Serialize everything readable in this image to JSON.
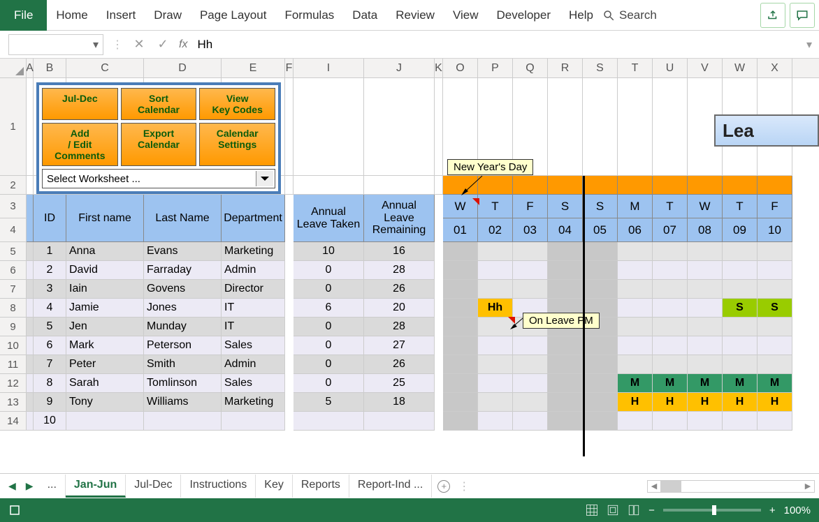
{
  "ribbon": {
    "file": "File",
    "tabs": [
      "Home",
      "Insert",
      "Draw",
      "Page Layout",
      "Formulas",
      "Data",
      "Review",
      "View",
      "Developer",
      "Help"
    ],
    "search": "Search"
  },
  "fx": {
    "value": "Hh"
  },
  "columns": [
    {
      "l": "A",
      "w": 10
    },
    {
      "l": "B",
      "w": 47
    },
    {
      "l": "C",
      "w": 111
    },
    {
      "l": "D",
      "w": 111
    },
    {
      "l": "E",
      "w": 91
    },
    {
      "l": "F",
      "w": 12
    },
    {
      "l": "I",
      "w": 101
    },
    {
      "l": "J",
      "w": 101
    },
    {
      "l": "K",
      "w": 12
    },
    {
      "l": "O",
      "w": 50
    },
    {
      "l": "P",
      "w": 50
    },
    {
      "l": "Q",
      "w": 50
    },
    {
      "l": "R",
      "w": 50
    },
    {
      "l": "S",
      "w": 50
    },
    {
      "l": "T",
      "w": 50
    },
    {
      "l": "U",
      "w": 50
    },
    {
      "l": "V",
      "w": 50
    },
    {
      "l": "W",
      "w": 50
    },
    {
      "l": "X",
      "w": 50
    }
  ],
  "panel": {
    "buttons": [
      [
        "Jul-Dec",
        "Sort Calendar",
        "View Key Codes"
      ],
      [
        "Add / Edit Comments",
        "Export Calendar",
        "Calendar Settings"
      ]
    ],
    "select": "Select Worksheet ..."
  },
  "headers": {
    "id": "ID",
    "fn": "First name",
    "ln": "Last Name",
    "dep": "Department",
    "alt": "Annual Leave Taken",
    "alr": "Annual Leave Remaining"
  },
  "days": [
    "W",
    "T",
    "F",
    "S",
    "S",
    "M",
    "T",
    "W",
    "T",
    "F"
  ],
  "dates": [
    "01",
    "02",
    "03",
    "04",
    "05",
    "06",
    "07",
    "08",
    "09",
    "10"
  ],
  "callouts": {
    "ny": "New Year's Day",
    "ol": "On Leave PM"
  },
  "banner": "Lea",
  "people": [
    {
      "id": 1,
      "fn": "Anna",
      "ln": "Evans",
      "dep": "Marketing",
      "alt": 10,
      "alr": 16
    },
    {
      "id": 2,
      "fn": "David",
      "ln": "Farraday",
      "dep": "Admin",
      "alt": 0,
      "alr": 28
    },
    {
      "id": 3,
      "fn": "Iain",
      "ln": "Govens",
      "dep": "Director",
      "alt": 0,
      "alr": 26
    },
    {
      "id": 4,
      "fn": "Jamie",
      "ln": "Jones",
      "dep": "IT",
      "alt": 6,
      "alr": 20
    },
    {
      "id": 5,
      "fn": "Jen",
      "ln": "Munday",
      "dep": "IT",
      "alt": 0,
      "alr": 28
    },
    {
      "id": 6,
      "fn": "Mark",
      "ln": "Peterson",
      "dep": "Sales",
      "alt": 0,
      "alr": 27
    },
    {
      "id": 7,
      "fn": "Peter",
      "ln": "Smith",
      "dep": "Admin",
      "alt": 0,
      "alr": 26
    },
    {
      "id": 8,
      "fn": "Sarah",
      "ln": "Tomlinson",
      "dep": "Sales",
      "alt": 0,
      "alr": 25
    },
    {
      "id": 9,
      "fn": "Tony",
      "ln": "Williams",
      "dep": "Marketing",
      "alt": 5,
      "alr": 18
    },
    {
      "id": 10,
      "fn": "",
      "ln": "",
      "dep": "",
      "alt": "",
      "alr": ""
    }
  ],
  "cal": {
    "4": {
      "1": {
        "t": "Hh",
        "c": "cell-hh"
      },
      "8": {
        "t": "S",
        "c": "cell-s"
      },
      "9": {
        "t": "S",
        "c": "cell-s"
      }
    },
    "8": {
      "5": {
        "t": "M",
        "c": "cell-m"
      },
      "6": {
        "t": "M",
        "c": "cell-m"
      },
      "7": {
        "t": "M",
        "c": "cell-m"
      },
      "8": {
        "t": "M",
        "c": "cell-m"
      },
      "9": {
        "t": "M",
        "c": "cell-m"
      }
    },
    "9": {
      "5": {
        "t": "H",
        "c": "cell-h"
      },
      "6": {
        "t": "H",
        "c": "cell-h"
      },
      "7": {
        "t": "H",
        "c": "cell-h"
      },
      "8": {
        "t": "H",
        "c": "cell-h"
      },
      "9": {
        "t": "H",
        "c": "cell-h"
      }
    }
  },
  "weekend_cols": [
    0,
    3,
    4
  ],
  "sheets": {
    "tabs": [
      "...",
      "Jan-Jun",
      "Jul-Dec",
      "Instructions",
      "Key",
      "Reports",
      "Report-Ind ..."
    ],
    "active": "Jan-Jun"
  },
  "status": {
    "zoom": "100%"
  }
}
